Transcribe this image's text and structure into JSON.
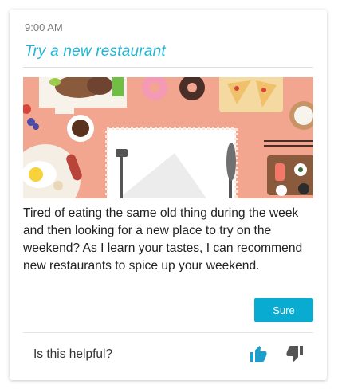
{
  "card": {
    "time": "9:00 AM",
    "title": "Try a new restaurant",
    "body": "Tired of eating the same old thing during the week and then looking for a new place to try on the weekend? As I learn your tastes, I can recommend new restaurants to spice up your weekend.",
    "action_label": "Sure"
  },
  "feedback": {
    "question": "Is this helpful?",
    "thumbs_up_icon": "thumbs-up-icon",
    "thumbs_down_icon": "thumbs-down-icon"
  },
  "colors": {
    "accent": "#1fb5d6",
    "button": "#0aabd0",
    "thumbs_up": "#1c9fcb",
    "thumbs_down": "#555555",
    "illustration_background": "#f2a58f"
  }
}
